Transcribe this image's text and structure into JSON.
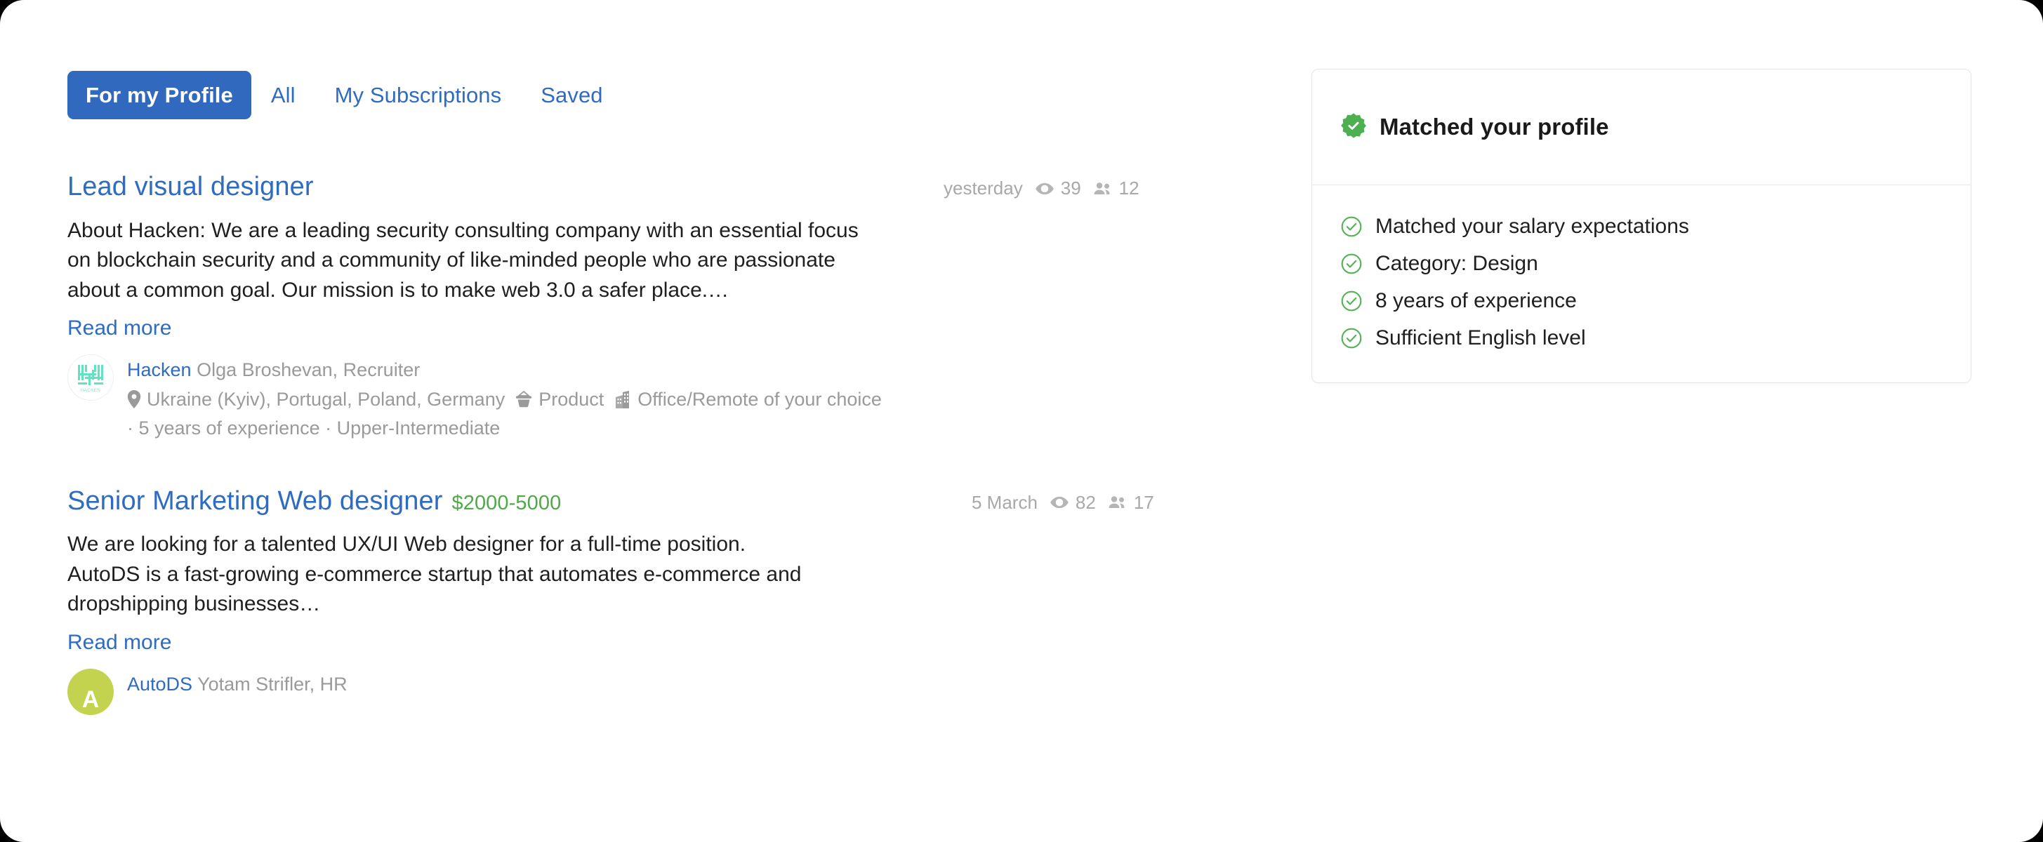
{
  "theme": {
    "accent_blue": "#3069bd",
    "link_blue": "#2f6cc0",
    "salary_green": "#51a848",
    "check_green": "#4caf50",
    "muted_gray": "#9a9a9a"
  },
  "tabs": [
    {
      "label": "For my Profile",
      "active": true
    },
    {
      "label": "All",
      "active": false
    },
    {
      "label": "My Subscriptions",
      "active": false
    },
    {
      "label": "Saved",
      "active": false
    }
  ],
  "jobs": [
    {
      "title": "Lead visual designer",
      "salary": "",
      "posted": "yesterday",
      "views": "39",
      "applicants": "12",
      "description_lines": [
        "About Hacken: We are a leading security consulting company with an essential focus",
        "on blockchain security and a community of like-minded people who are passionate",
        "about a common goal. Our mission is to make web 3.0 a safer place.…"
      ],
      "read_more": "Read more",
      "company": "Hacken",
      "contact": "Olga Broshevan, Recruiter",
      "location": "Ukraine (Kyiv), Portugal, Poland, Germany",
      "product": "Product",
      "office": "Office/Remote of your choice",
      "experience_line": "· 5 years of experience · Upper-Intermediate",
      "avatar_text": "HACKEN"
    },
    {
      "title": "Senior Marketing Web designer",
      "salary": "$2000-5000",
      "posted": "5 March",
      "views": "82",
      "applicants": "17",
      "description_lines": [
        "We are looking for a talented UX/UI Web designer for a full-time position.",
        "AutoDS is a fast-growing e-commerce startup that automates e-commerce and",
        "dropshipping businesses…"
      ],
      "read_more": "Read more",
      "company": "AutoDS",
      "contact": "Yotam Strifler, HR",
      "avatar_text": "A"
    }
  ],
  "matched_panel": {
    "title": "Matched your profile",
    "items": [
      "Matched your salary expectations",
      "Category: Design",
      "8 years of experience",
      "Sufficient English level"
    ]
  },
  "icons": {
    "eye": "eye-icon",
    "people": "people-icon",
    "pin": "map-pin-icon",
    "basket": "product-basket-icon",
    "building": "office-building-icon",
    "badge_check": "verified-badge-icon",
    "circle_check": "circle-check-icon"
  }
}
